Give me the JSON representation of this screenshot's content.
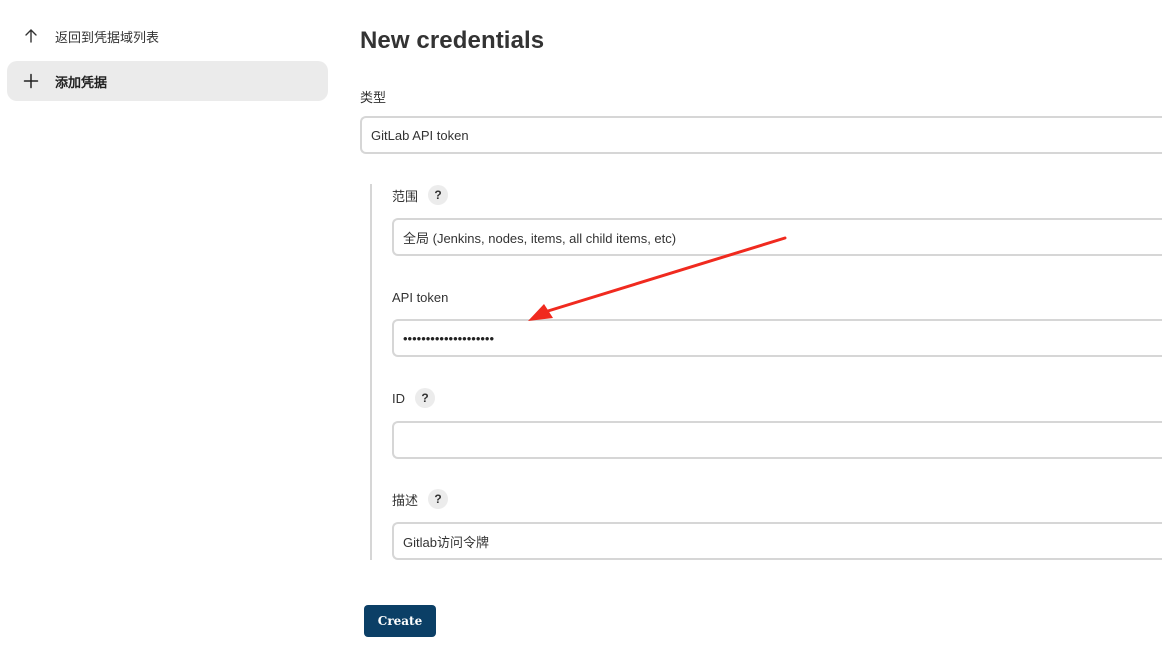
{
  "sidebar": {
    "items": [
      {
        "label": "返回到凭据域列表",
        "icon": "arrow-up-icon"
      },
      {
        "label": "添加凭据",
        "icon": "plus-icon",
        "active": true
      }
    ]
  },
  "main": {
    "title": "New credentials",
    "kind": {
      "label": "类型",
      "value": "GitLab API token"
    },
    "scope": {
      "label": "范围",
      "help": "?",
      "value": "全局 (Jenkins, nodes, items, all child items, etc)"
    },
    "api_token": {
      "label": "API token",
      "value": "••••••••••••••••••••"
    },
    "id": {
      "label": "ID",
      "help": "?",
      "value": ""
    },
    "description": {
      "label": "描述",
      "help": "?",
      "value": "Gitlab访问令牌"
    },
    "create_label": "Create"
  },
  "annotation": {
    "color": "#f02a1f"
  }
}
